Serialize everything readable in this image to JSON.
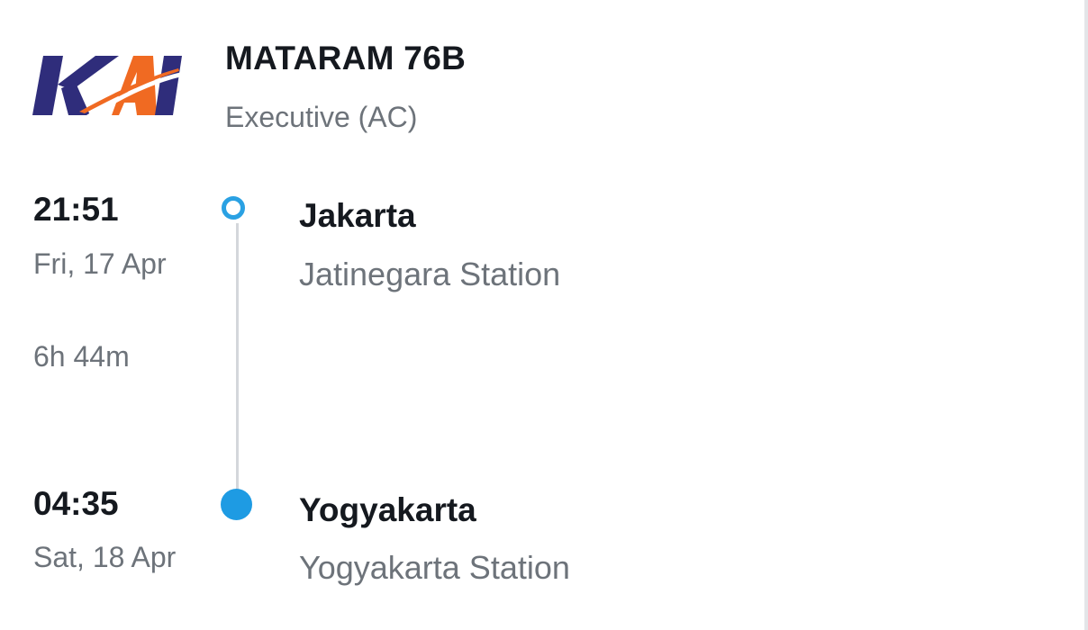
{
  "train": {
    "operator_logo": "KAI",
    "name": "MATARAM 76B",
    "class": "Executive (AC)"
  },
  "departure": {
    "time": "21:51",
    "date": "Fri, 17 Apr",
    "city": "Jakarta",
    "station": "Jatinegara Station"
  },
  "duration": "6h 44m",
  "arrival": {
    "time": "04:35",
    "date": "Sat, 18 Apr",
    "city": "Yogyakarta",
    "station": "Yogyakarta Station"
  },
  "colors": {
    "logo_navy": "#2f2d7b",
    "logo_orange": "#f06a22",
    "timeline_accent": "#1e9be3",
    "text_primary": "#15191f",
    "text_secondary": "#6d737a"
  },
  "icons": {
    "departure_marker": "hollow-circle",
    "arrival_marker": "filled-circle"
  }
}
